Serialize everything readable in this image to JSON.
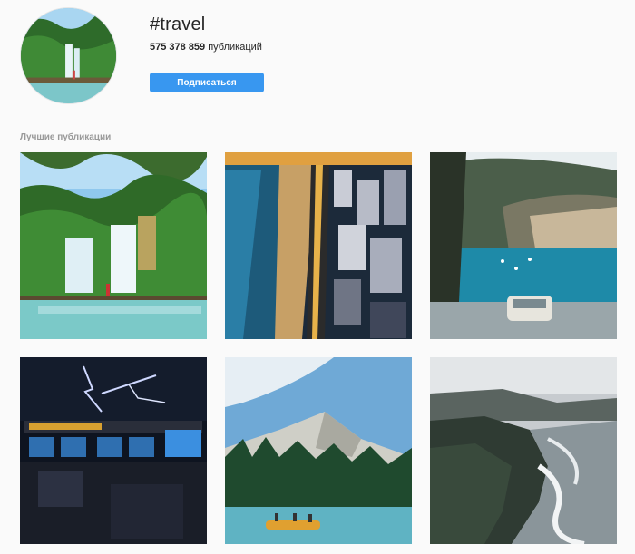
{
  "profile": {
    "hashtag": "#travel",
    "post_count": "575 378 859",
    "post_count_suffix": " публикаций",
    "subscribe_label": "Подписаться"
  },
  "section": {
    "top_posts_label": "Лучшие публикации"
  },
  "colors": {
    "accent": "#3897f0",
    "background": "#fafafa",
    "muted_text": "#999999"
  }
}
